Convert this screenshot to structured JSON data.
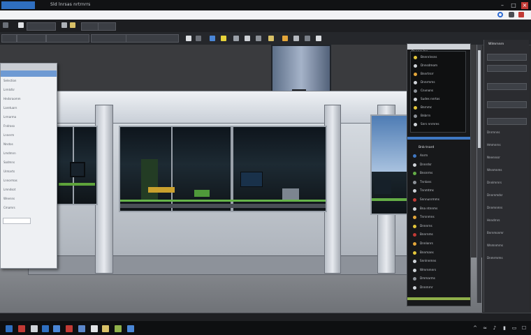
{
  "window": {
    "title": "Sld lnrsas nrtrnrrs"
  },
  "toolbar": {
    "row1_buttons": [
      "",
      "",
      "",
      ""
    ],
    "row2_tabs": [
      "",
      "",
      ""
    ]
  },
  "colors": {
    "accent_blue": "#3f78c4",
    "accent_green": "#8fb04a",
    "close_red": "#c23a35",
    "panel_dark": "#17181a",
    "titlebar": "#111214"
  },
  "left_panel": {
    "rows": [
      "Selection",
      "Lrmlsfsr",
      "Hndsraomm",
      "Laretuarn",
      "Lrmarma",
      "Fndraso",
      "Lnnerm",
      "Nnstos",
      "Lmdmnn",
      "Sodmns",
      "Urmarts",
      "Lnnormas",
      "Lmndsot",
      "Wnenns",
      "Cmamrs"
    ]
  },
  "props_panel": {
    "header": "Bnonrr lns",
    "top_rows": [
      "Bnnnrinsns",
      "Dnnsdmom",
      "Bnnrtrsrr",
      "Dnnrmms",
      "Cnvnons",
      "Sudes nnrtos",
      "Bnrnmc",
      "Bnbrrn",
      "Snrs nnrnres"
    ],
    "bottom_header": "Bnb tnard",
    "bottom_rows": [
      "Anrm",
      "Dnnrdsr",
      "Bnsnrms",
      "Tnnlans",
      "Tnnmtms",
      "Snnnunrmms",
      "Bna ntnnms",
      "Tnrsnmns",
      "Dnnnrns",
      "Bnnrnms",
      "Dnnlonrs",
      "Bnnmans",
      "Snnlnnmns",
      "Wmrnmnrs",
      "Dmmarms",
      "Dnnmrnr"
    ]
  },
  "far_panel": {
    "header": "Wlmrnnrn",
    "rows": [
      "Dnrrnnns",
      "Hmmnrns",
      "Nnennssr",
      "Wnnmnms",
      "Dnnlmrnrs",
      "Dnnrnmdsr",
      "Dnnmnmrs",
      "Hnndrnrs",
      "Bnrnmonmr",
      "Wnmnmrns",
      "Dnmrmrms"
    ]
  },
  "icons": [
    "gear-icon",
    "folder-icon",
    "search-icon",
    "close-icon",
    "minimize-icon",
    "maximize-icon",
    "windows-start-icon",
    "wifi-icon",
    "speaker-icon"
  ]
}
